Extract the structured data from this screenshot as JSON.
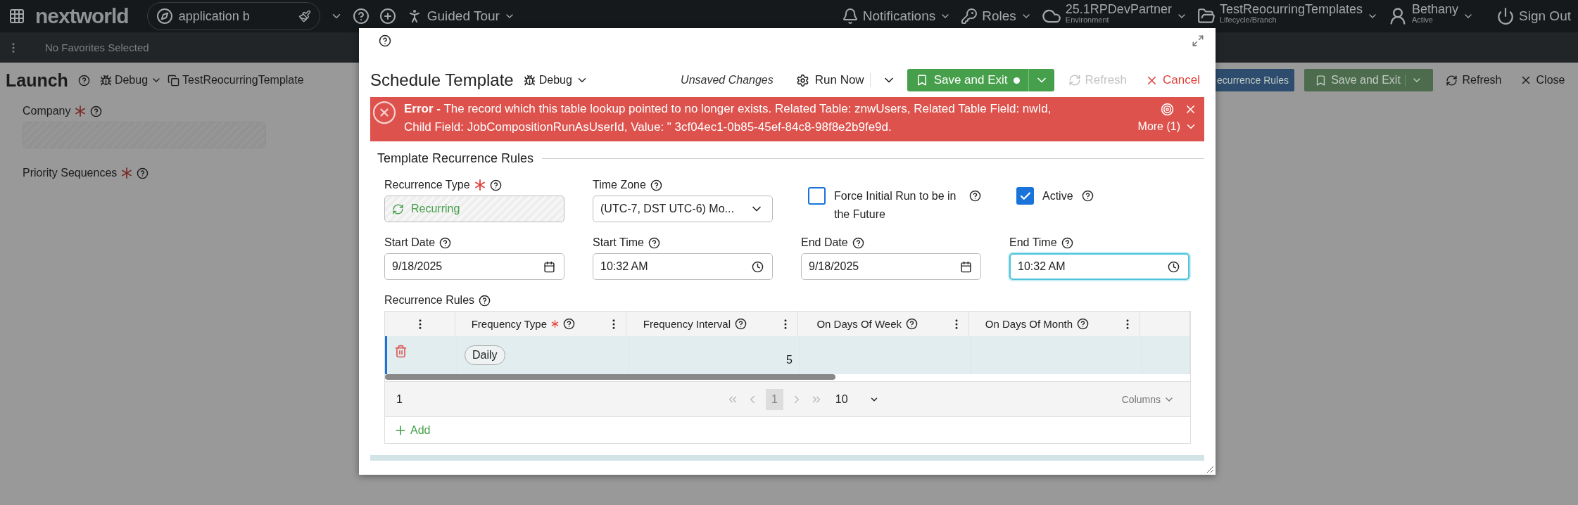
{
  "top_bar": {
    "logo": "nextworld",
    "search": {
      "value": "application b"
    },
    "guided_tour": "Guided Tour",
    "notifications": "Notifications",
    "roles": "Roles",
    "environment": {
      "value": "25.1RPDevPartner",
      "caption": "Environment"
    },
    "lifecycle": {
      "value": "TestReocurringTemplates",
      "caption": "Lifecycle/Branch"
    },
    "user": {
      "name": "Bethany",
      "status": "Active"
    },
    "sign_out": "Sign Out"
  },
  "favorites_bar": {
    "text": "No Favorites Selected"
  },
  "page": {
    "title": "Launch",
    "debug": "Debug",
    "record": "TestReocurringTemplate",
    "fields": [
      {
        "label": "Company",
        "required": true
      },
      {
        "label": "Priority Sequences",
        "required": true
      }
    ],
    "actions": [
      {
        "kind": "primary",
        "label": "ecurrence Rules"
      },
      {
        "kind": "split",
        "label": "Save and Exit"
      },
      {
        "kind": "refresh",
        "label": "Refresh"
      },
      {
        "kind": "close",
        "label": "Close"
      }
    ]
  },
  "modal": {
    "title": "Schedule Template",
    "debug": "Debug",
    "status": "Unsaved Changes",
    "run_now": "Run Now",
    "save": {
      "label": "Save and Exit",
      "unsaved": true
    },
    "refresh": {
      "label": "Refresh",
      "disabled": true
    },
    "cancel": "Cancel",
    "error": {
      "message": "**Error -** The record which this table lookup pointed to no longer exists. Related Table: znwUsers, Related Table Field: nwId, Child Field: JobCompositionRunAsUserId, Value: \" 3cf04ec1-0b85-45ef-84c8-98f8e2b9fe9d.",
      "more": "More (1)"
    },
    "section": "Template Recurrence Rules",
    "fields": [
      {
        "kind": "readonly",
        "label": "Recurrence Type",
        "required": true,
        "focused": false,
        "value": "Recurring"
      },
      {
        "kind": "select",
        "label": "Time Zone",
        "required": false,
        "focused": false,
        "value": "(UTC-7, DST UTC-6) Mo..."
      },
      {
        "kind": "checkbox",
        "label": "Force Initial Run to be in the Future",
        "checked": false
      },
      {
        "kind": "checkbox",
        "label": "Active",
        "checked": true
      },
      {
        "kind": "date",
        "label": "Start Date",
        "required": false,
        "focused": false,
        "value": "9/18/2025"
      },
      {
        "kind": "time",
        "label": "Start Time",
        "required": false,
        "focused": false,
        "value": "10:32 AM"
      },
      {
        "kind": "date",
        "label": "End Date",
        "required": false,
        "focused": false,
        "value": "9/18/2025"
      },
      {
        "kind": "time",
        "label": "End Time",
        "required": false,
        "focused": true,
        "value": "10:32 AM"
      }
    ],
    "table": {
      "label": "Recurrence Rules",
      "columns": [
        {
          "label": "Frequency Type",
          "required": true
        },
        {
          "label": "Frequency Interval",
          "required": false
        },
        {
          "label": "On Days Of Week",
          "required": false
        },
        {
          "label": "On Days Of Month",
          "required": false
        }
      ],
      "rows": [
        {
          "selected": true,
          "frequency_type": "Daily",
          "frequency_interval": "5"
        }
      ],
      "footer": {
        "count": "1",
        "page": "1",
        "page_size": "10",
        "columns_button": "Columns"
      },
      "add": "Add"
    }
  }
}
